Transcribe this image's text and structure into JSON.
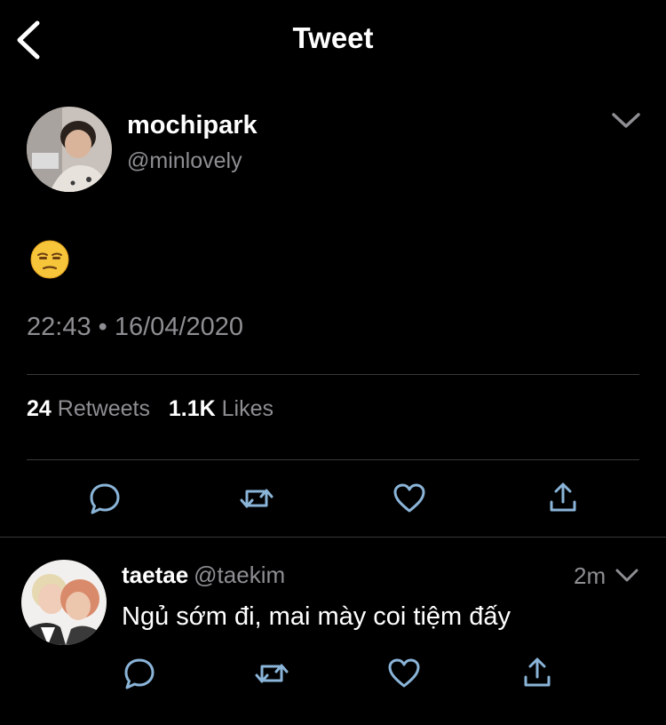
{
  "header": {
    "title": "Tweet"
  },
  "tweet": {
    "display_name": "mochipark",
    "handle": "@minlovely",
    "content_emoji": "unamused-face",
    "timestamp": "22:43 • 16/04/2020",
    "retweet_count": "24",
    "retweet_label": "Retweets",
    "like_count": "1.1K",
    "like_label": "Likes"
  },
  "reply": {
    "display_name": "taetae",
    "handle": "@taekim",
    "time": "2m",
    "text": "Ngủ sớm đi, mai mày coi tiệm đấy"
  },
  "icons": [
    "back-chevron-icon",
    "chevron-down-icon",
    "reply-icon",
    "retweet-icon",
    "like-icon",
    "share-icon"
  ],
  "colors": {
    "background": "#000000",
    "secondary_text": "#8e8e93",
    "divider": "#38383a",
    "icon": "#8ab4d8"
  }
}
